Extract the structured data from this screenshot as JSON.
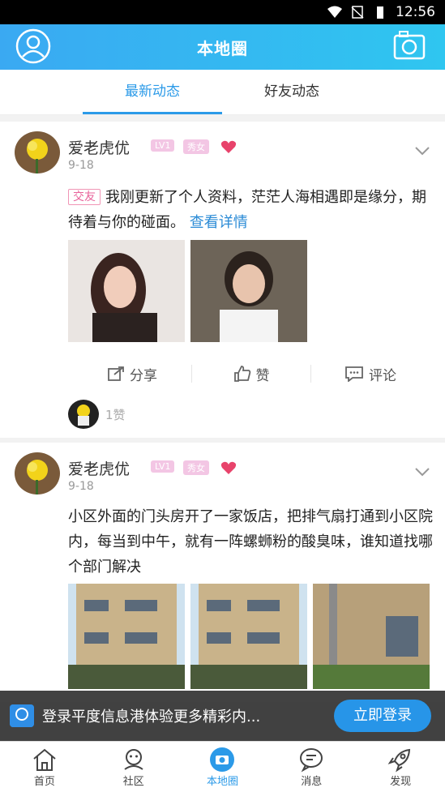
{
  "status": {
    "time": "12:56"
  },
  "header": {
    "title": "本地圈"
  },
  "tabs": [
    {
      "label": "最新动态"
    },
    {
      "label": "好友动态"
    }
  ],
  "posts": [
    {
      "name": "爱老虎优",
      "level": "LV1",
      "gender_badge": "秀女",
      "date": "9-18",
      "tag": "交友",
      "text": "我刚更新了个人资料，茫茫人海相遇即是缘分，期待着与你的碰面。",
      "link": "查看详情",
      "actions": {
        "share": "分享",
        "like": "赞",
        "comment": "评论"
      },
      "likes_text": "1赞"
    },
    {
      "name": "爱老虎优",
      "level": "LV1",
      "gender_badge": "秀女",
      "date": "9-18",
      "text": "小区外面的门头房开了一家饭店，把排气扇打通到小区院内，每当到中午，就有一阵螺蛳粉的酸臭味，谁知道找哪个部门解决"
    }
  ],
  "banner": {
    "text": "登录平度信息港体验更多精彩内...",
    "button": "立即登录"
  },
  "bottom_nav": [
    {
      "label": "首页",
      "icon": "home-icon"
    },
    {
      "label": "社区",
      "icon": "community-icon"
    },
    {
      "label": "本地圈",
      "icon": "local-circle-icon"
    },
    {
      "label": "消息",
      "icon": "message-icon"
    },
    {
      "label": "发现",
      "icon": "rocket-icon"
    }
  ],
  "colors": {
    "accent": "#2b9ae8",
    "header_start": "#3aa9f2",
    "header_end": "#2fc6f0"
  }
}
